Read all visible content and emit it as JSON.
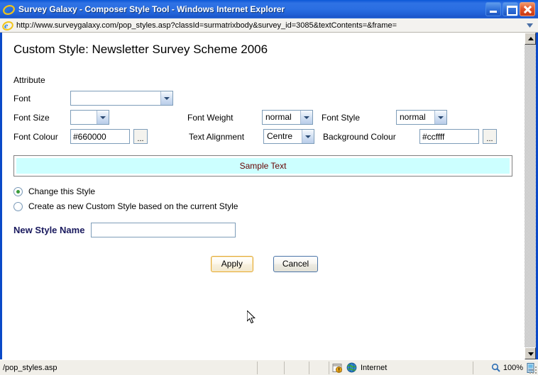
{
  "window": {
    "title": "Survey Galaxy - Composer Style Tool - Windows Internet Explorer",
    "icon": "ie-logo-icon",
    "buttons": {
      "minimize": "Minimize",
      "maximize": "Maximize",
      "close": "Close"
    }
  },
  "address_bar": {
    "icon": "ie-logo-icon",
    "url": "http://www.surveygalaxy.com/pop_styles.asp?classId=surmatrixbody&survey_id=3085&textContents=&frame=",
    "dropdown_icon": "chevron-down-icon"
  },
  "page": {
    "title": "Custom Style: Newsletter Survey Scheme 2006",
    "attribute_label": "Attribute",
    "fields": {
      "font": {
        "label": "Font",
        "value": "",
        "control": "dropdown"
      },
      "font_size": {
        "label": "Font Size",
        "value": "",
        "control": "dropdown"
      },
      "font_weight": {
        "label": "Font Weight",
        "value": "normal",
        "control": "dropdown"
      },
      "font_style": {
        "label": "Font Style",
        "value": "normal",
        "control": "dropdown"
      },
      "font_colour": {
        "label": "Font Colour",
        "value": "#660000",
        "control": "text",
        "picker_label": "..."
      },
      "text_alignment": {
        "label": "Text Alignment",
        "value": "Centre",
        "control": "dropdown"
      },
      "background_colour": {
        "label": "Background Colour",
        "value": "#ccffff",
        "control": "text",
        "picker_label": "..."
      }
    },
    "sample": {
      "text": "Sample Text",
      "text_colour": "#660000",
      "background_colour": "#ccffff"
    },
    "options": [
      {
        "label": "Change this Style",
        "selected": true
      },
      {
        "label": "Create as new Custom Style based on the current Style",
        "selected": false
      }
    ],
    "new_style": {
      "label": "New Style Name",
      "value": "",
      "placeholder": ""
    },
    "actions": {
      "apply": "Apply",
      "cancel": "Cancel"
    }
  },
  "status_bar": {
    "url": "/pop_styles.asp",
    "security_icon": "security-warning-icon",
    "zone_icon": "globe-icon",
    "zone": "Internet",
    "zoom_icon": "magnifier-icon",
    "zoom": "100%",
    "zoom_control_icon": "zoom-control-icon"
  },
  "colors": {
    "title_bar": "#2a6ee2",
    "window_border": "#0a49c8",
    "accent_hover": "#e0a93b",
    "sample_bg": "#ccffff",
    "sample_fg": "#660000",
    "label_navy": "#1a1a5e"
  }
}
